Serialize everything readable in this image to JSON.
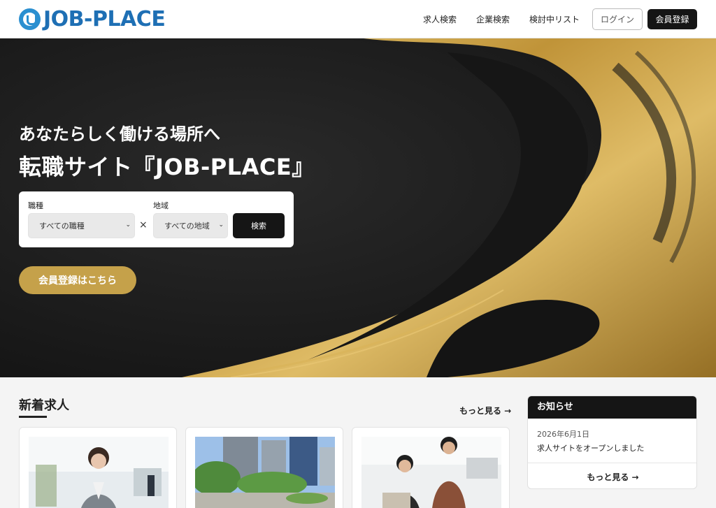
{
  "header": {
    "logo_text": "JOB-PLACE",
    "nav": [
      "求人検索",
      "企業検索",
      "検討中リスト"
    ],
    "login_label": "ログイン",
    "register_label": "会員登録"
  },
  "hero": {
    "title_line1": "あなたらしく働ける場所へ",
    "title_line2": "転職サイト『JOB-PLACE』",
    "search": {
      "job_label": "職種",
      "job_value": "すべての職種",
      "area_label": "地域",
      "area_value": "すべての地域",
      "times_symbol": "×",
      "search_label": "検索"
    },
    "cta_label": "会員登録はこちら"
  },
  "jobs": {
    "title": "新着求人",
    "more_label": "もっと見る →"
  },
  "news": {
    "title": "お知らせ",
    "items": [
      {
        "date": "2026年6月1日",
        "text": "求人サイトをオープンしました"
      }
    ],
    "more_label": "もっと見る →"
  },
  "colors": {
    "brand_blue": "#1e6fb4",
    "gold": "#c5a14a",
    "dark": "#151515"
  }
}
